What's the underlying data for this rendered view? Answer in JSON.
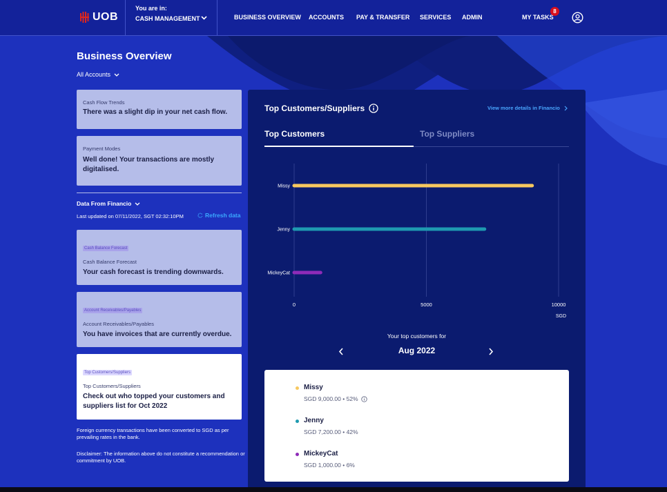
{
  "header": {
    "logo": "UOB",
    "context_label": "You are in:",
    "context_value": "CASH MANAGEMENT",
    "nav": [
      "BUSINESS OVERVIEW",
      "ACCOUNTS",
      "PAY & TRANSFER",
      "SERVICES",
      "ADMIN"
    ],
    "tasks_label": "MY TASKS",
    "tasks_count": "8"
  },
  "page": {
    "title": "Business Overview",
    "accounts_filter": "All Accounts"
  },
  "cards_top": [
    {
      "label": "Cash Flow Trends",
      "message": "There was a slight dip in your net cash flow."
    },
    {
      "label": "Payment Modes",
      "message": "Well done! Your transactions are mostly digitalised."
    }
  ],
  "financio": {
    "title": "Data From Financio",
    "last_updated": "Last updated on 07/11/2022, SGT 02:32:10PM",
    "refresh": "Refresh data"
  },
  "cards_financio": [
    {
      "chip": "Cash Balance Forecast",
      "label": "Cash Balance Forecast",
      "message": "Your cash forecast is trending downwards."
    },
    {
      "chip": "Account Receivables/Payables",
      "label": "Account Receivables/Payables",
      "message": "You have invoices that are currently overdue."
    },
    {
      "chip": "Top Customers/Suppliers",
      "label": "Top Customers/Suppliers",
      "message": "Check out who topped your customers and suppliers list for Oct 2022"
    }
  ],
  "footnotes": {
    "currency": "Foreign currency transactions have been converted to SGD as per prevailing rates in the bank.",
    "disclaimer": "Disclaimer: The information above do not constitute a recommendation or commitment by UOB."
  },
  "panel": {
    "title": "Top Customers/Suppliers",
    "view_more": "View more details in Financio",
    "tabs": [
      "Top Customers",
      "Top Suppliers"
    ],
    "period_caption": "Your top customers for",
    "period": "Aug 2022"
  },
  "chart_data": {
    "type": "bar",
    "orientation": "horizontal",
    "categories": [
      "Missy",
      "Jenny",
      "MickeyCat"
    ],
    "values": [
      9000,
      7200,
      1000
    ],
    "colors": [
      "#f7c85f",
      "#1e9ab0",
      "#8e2bb8"
    ],
    "xticks": [
      "0",
      "5000",
      "10000"
    ],
    "xlim": [
      0,
      10000
    ],
    "xunit": "SGD",
    "grid": true
  },
  "legend": [
    {
      "name": "Missy",
      "detail": "SGD  9,000.00 • 52%",
      "color": "#f7c85f",
      "info": true
    },
    {
      "name": "Jenny",
      "detail": "SGD  7,200.00 • 42%",
      "color": "#1e9ab0",
      "info": false
    },
    {
      "name": "MickeyCat",
      "detail": "SGD  1,000.00 • 6%",
      "color": "#8e2bb8",
      "info": false
    }
  ]
}
